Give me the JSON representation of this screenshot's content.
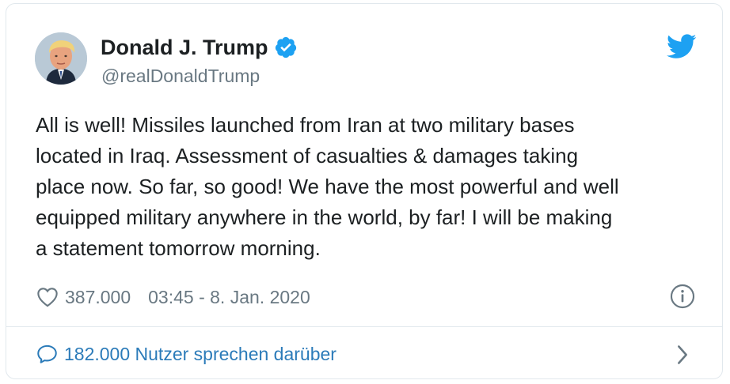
{
  "author": {
    "display_name": "Donald J. Trump",
    "handle": "@realDonaldTrump",
    "verified": true
  },
  "tweet": {
    "text": "All is well! Missiles launched from Iran at two military bases\nlocated in Iraq. Assessment of casualties & damages taking\nplace now. So far, so good! We have the most powerful and well\nequipped military anywhere in the world, by far! I will be making\na statement tomorrow morning.",
    "like_count": "387.000",
    "timestamp": "03:45 - 8. Jan. 2020",
    "conversation_label": "182.000 Nutzer sprechen darüber"
  },
  "icons": {
    "brand": "twitter-bird-icon",
    "verified": "verified-badge-icon",
    "like": "heart-icon",
    "info": "info-icon",
    "conversation": "speech-bubble-icon",
    "chevron": "chevron-right-icon"
  },
  "colors": {
    "twitter_blue": "#1da1f2",
    "link_blue": "#2b7bb9",
    "text": "#1c2022",
    "muted": "#697882",
    "border": "#e1e8ed"
  }
}
